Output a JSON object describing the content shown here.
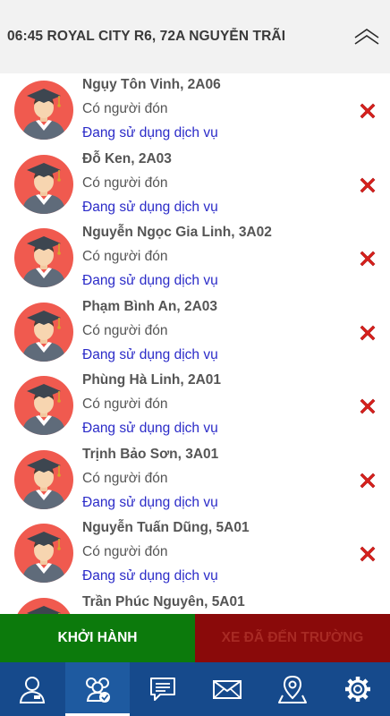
{
  "header": {
    "title": "06:45 ROYAL CITY R6, 72A NGUYỄN TRÃI",
    "collapse_icon": "chevron-up-double-icon"
  },
  "students": [
    {
      "name": "Ngụy Tôn Vinh, 2A06",
      "pickup_status": "Có người đón",
      "service_status": "Đang sử dụng dịch vụ"
    },
    {
      "name": "Đỗ Ken, 2A03",
      "pickup_status": "Có người đón",
      "service_status": "Đang sử dụng dịch vụ"
    },
    {
      "name": "Nguyễn Ngọc Gia Linh, 3A02",
      "pickup_status": "Có người đón",
      "service_status": "Đang sử dụng dịch vụ"
    },
    {
      "name": "Phạm Bình An, 2A03",
      "pickup_status": "Có người đón",
      "service_status": "Đang sử dụng dịch vụ"
    },
    {
      "name": "Phùng Hà Linh, 2A01",
      "pickup_status": "Có người đón",
      "service_status": "Đang sử dụng dịch vụ"
    },
    {
      "name": "Trịnh Bảo Sơn, 3A01",
      "pickup_status": "Có người đón",
      "service_status": "Đang sử dụng dịch vụ"
    },
    {
      "name": "Nguyễn Tuấn Dũng, 5A01",
      "pickup_status": "Có người đón",
      "service_status": "Đang sử dụng dịch vụ"
    },
    {
      "name": "Trần Phúc Nguyên, 5A01",
      "pickup_status": "",
      "service_status": ""
    }
  ],
  "actions": {
    "depart_label": "KHỞI HÀNH",
    "arrived_label": "XE ĐÃ ĐẾN TRƯỜNG"
  },
  "nav": [
    {
      "icon": "student-profile-icon",
      "active": false
    },
    {
      "icon": "group-check-icon",
      "active": true
    },
    {
      "icon": "chat-icon",
      "active": false
    },
    {
      "icon": "mail-icon",
      "active": false
    },
    {
      "icon": "map-pin-icon",
      "active": false
    },
    {
      "icon": "settings-gear-icon",
      "active": false
    }
  ],
  "colors": {
    "header_bg": "#f2f2f2",
    "avatar_bg": "#f05a4f",
    "service_text": "#2b2bc8",
    "remove_icon": "#d8201c",
    "depart_bg": "#0c7a0c",
    "arrived_bg": "#8a0a0a",
    "nav_bg": "#164a8c"
  }
}
